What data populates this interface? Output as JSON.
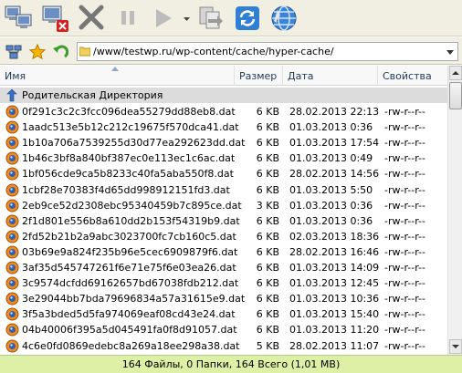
{
  "toolbar": {
    "buttons": [
      {
        "name": "connect-computers-button",
        "icon": "network-computers-icon"
      },
      {
        "name": "disconnect-button",
        "icon": "disconnect-computer-icon"
      },
      {
        "name": "cancel-button",
        "icon": "cancel-x-icon"
      },
      {
        "name": "pause-button",
        "icon": "pause-icon"
      },
      {
        "name": "play-button",
        "icon": "play-icon"
      },
      {
        "name": "transfer-copy-button",
        "icon": "copy-transfer-icon"
      },
      {
        "name": "refresh-button",
        "icon": "refresh-icon"
      },
      {
        "name": "browser-button",
        "icon": "globe-icon"
      }
    ]
  },
  "address": {
    "path": "/www/testwp.ru/wp-content/cache/hyper-cache/"
  },
  "columns": {
    "name": "Имя",
    "size": "Размер",
    "date": "Дата",
    "attr": "Свойства"
  },
  "parent_row": {
    "label": "Родительская Директория"
  },
  "files": [
    {
      "name": "0f291c3c2c3fcc096dea55279dd88eb8.dat",
      "size": "6 KB",
      "date": "28.02.2013 22:13",
      "attr": "-rw-r--r--"
    },
    {
      "name": "1aadc513e5b12c212c19675f570dca41.dat",
      "size": "6 KB",
      "date": "01.03.2013 0:36",
      "attr": "-rw-r--r--"
    },
    {
      "name": "1b10a706a7539255d30d77ea292623dd.dat",
      "size": "6 KB",
      "date": "01.03.2013 17:54",
      "attr": "-rw-r--r--"
    },
    {
      "name": "1b46c3bf8a840bf387ec0e113ec1c6ac.dat",
      "size": "6 KB",
      "date": "01.03.2013 0:49",
      "attr": "-rw-r--r--"
    },
    {
      "name": "1bf056cde9ca5b8233c40fa5aba550f8.dat",
      "size": "6 KB",
      "date": "28.02.2013 14:56",
      "attr": "-rw-r--r--"
    },
    {
      "name": "1cbf28e70383f4d65dd998912151fd3.dat",
      "size": "6 KB",
      "date": "01.03.2013 5:50",
      "attr": "-rw-r--r--"
    },
    {
      "name": "2eb9ce52d2308ebc95340459b7c895ce.dat",
      "size": "3 KB",
      "date": "01.03.2013 0:36",
      "attr": "-rw-r--r--"
    },
    {
      "name": "2f1d801e556b8a610dd2b153f54319b9.dat",
      "size": "6 KB",
      "date": "01.03.2013 0:36",
      "attr": "-rw-r--r--"
    },
    {
      "name": "2fd52b21b2a9abc3023700fc7cb160c5.dat",
      "size": "6 KB",
      "date": "02.03.2013 18:36",
      "attr": "-rw-r--r--"
    },
    {
      "name": "03b69e9a824f235b96e5cec6909879f6.dat",
      "size": "6 KB",
      "date": "28.02.2013 16:46",
      "attr": "-rw-r--r--"
    },
    {
      "name": "3af35d545747261f6e71e75f6e03ea26.dat",
      "size": "6 KB",
      "date": "01.03.2013 14:09",
      "attr": "-rw-r--r--"
    },
    {
      "name": "3c9574dcfdd69162657bd67038fdb212.dat",
      "size": "6 KB",
      "date": "01.03.2013 12:45",
      "attr": "-rw-r--r--"
    },
    {
      "name": "3e29044bb7bda79696834a57a31615e9.dat",
      "size": "6 KB",
      "date": "01.03.2013 10:36",
      "attr": "-rw-r--r--"
    },
    {
      "name": "3f5a3bded5d5fa974069eaf08cd43e24.dat",
      "size": "6 KB",
      "date": "01.03.2013 15:40",
      "attr": "-rw-r--r--"
    },
    {
      "name": "04b40006f395a5d045491fa0f8d91057.dat",
      "size": "6 KB",
      "date": "01.03.2013 11:20",
      "attr": "-rw-r--r--"
    },
    {
      "name": "4c6e0fd0869edebc8a269a18ee298a38.dat",
      "size": "5 KB",
      "date": "28.02.2013 11:07",
      "attr": "-rw-r--r--"
    }
  ],
  "status": {
    "text": "164 Файлы, 0 Папки, 164 Всего (1,01 MB)"
  },
  "colors": {
    "toolbar_bg": "#f1efe2",
    "status_bg": "#ddf0a6",
    "parent_row_bg": "#dcdcdc"
  }
}
